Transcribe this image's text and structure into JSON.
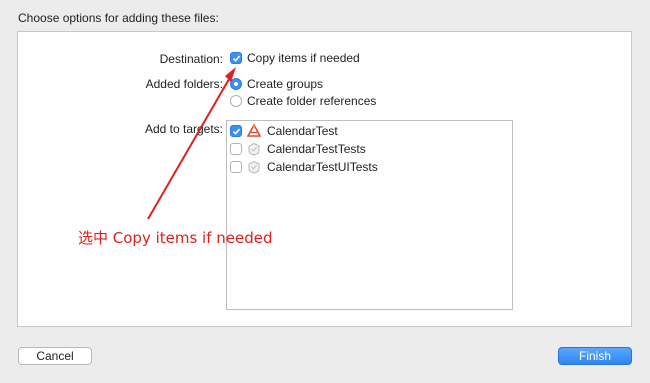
{
  "dialog": {
    "title": "Choose options for adding these files:"
  },
  "destination": {
    "label": "Destination:",
    "copy_items": {
      "label": "Copy items if needed",
      "checked": true
    }
  },
  "added_folders": {
    "label": "Added folders:",
    "options": [
      {
        "label": "Create groups",
        "selected": true
      },
      {
        "label": "Create folder references",
        "selected": false
      }
    ]
  },
  "targets": {
    "label": "Add to targets:",
    "items": [
      {
        "name": "CalendarTest",
        "checked": true,
        "icon": "app-target-icon"
      },
      {
        "name": "CalendarTestTests",
        "checked": false,
        "icon": "test-target-icon"
      },
      {
        "name": "CalendarTestUITests",
        "checked": false,
        "icon": "test-target-icon"
      }
    ]
  },
  "annotation": {
    "text": "选中 Copy items if needed",
    "color": "#e0201b"
  },
  "buttons": {
    "cancel": "Cancel",
    "finish": "Finish"
  },
  "colors": {
    "accent": "#3d8ef5",
    "background": "#ececec"
  }
}
